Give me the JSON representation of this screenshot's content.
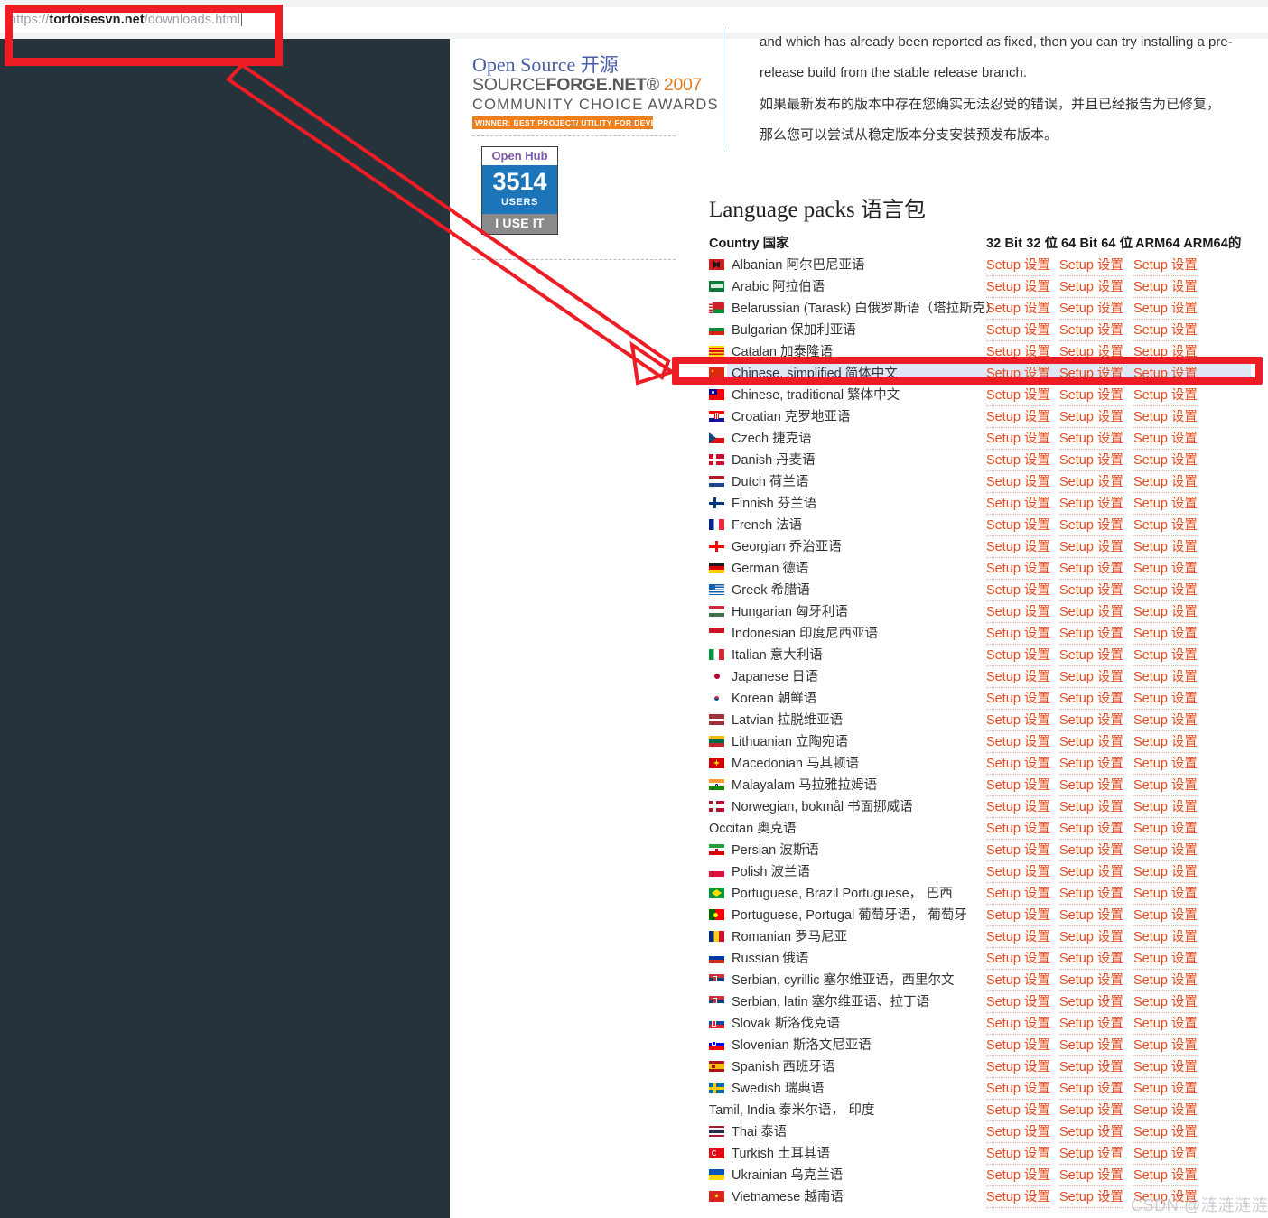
{
  "browser": {
    "url_scheme": "https://",
    "url_host": "tortoisesvn.net",
    "url_path": "/downloads.html",
    "url_full": "https://tortoisesvn.net/downloads.html"
  },
  "sidebar_widgets": {
    "sourceforge_award": {
      "line1_en": "Open Source ",
      "line1_cn": "开源",
      "line2_plain": "SOURCE",
      "line2_bold": "FORGE.NET",
      "line2_reg": "®",
      "line2_year": "2007",
      "line3": "COMMUNITY  CHOICE  AWARDS",
      "banner": "WINNER: BEST PROJECT/ UTILITY FOR DEVELOPERS"
    },
    "openhub_badge": {
      "title": "Open Hub",
      "count": "3514",
      "unit": "USERS",
      "cta": "I USE IT"
    }
  },
  "article": {
    "paragraph_en_clipped": "and which has already been reported as fixed, then you can try installing a pre-",
    "paragraph_en_line2": "release build from the stable release branch.",
    "paragraph_cn_line1": "如果最新发布的版本中存在您确实无法忍受的错误，并且已经报告为已修复，",
    "paragraph_cn_line2": "那么您可以尝试从稳定版本分支安装预发布版本。"
  },
  "language_packs": {
    "heading_en": "Language packs ",
    "heading_cn": "语言包",
    "columns": {
      "country": "Country 国家",
      "bit32": "32 Bit 32 位",
      "bit64": "64 Bit 64 位",
      "arm64": "ARM64 ARM64的"
    },
    "setup_label_en": "Setup ",
    "setup_label_cn": "设置",
    "rows": [
      {
        "flag": "f-albania",
        "name_en": "Albanian ",
        "name_cn": "阿尔巴尼亚语"
      },
      {
        "flag": "f-arabic",
        "name_en": "Arabic ",
        "name_cn": "阿拉伯语"
      },
      {
        "flag": "f-belarus",
        "name_en": "Belarussian (Tarask) ",
        "name_cn": "白俄罗斯语（塔拉斯克）"
      },
      {
        "flag": "f-bulgaria",
        "name_en": "Bulgarian ",
        "name_cn": "保加利亚语"
      },
      {
        "flag": "f-catalan",
        "name_en": "Catalan ",
        "name_cn": "加泰隆语"
      },
      {
        "flag": "f-china",
        "name_en": "Chinese, simplified ",
        "name_cn": "简体中文",
        "selected": true
      },
      {
        "flag": "f-taiwan",
        "name_en": "Chinese, traditional ",
        "name_cn": "繁体中文"
      },
      {
        "flag": "f-croatia",
        "name_en": "Croatian ",
        "name_cn": "克罗地亚语"
      },
      {
        "flag": "f-czech",
        "name_en": "Czech ",
        "name_cn": "捷克语"
      },
      {
        "flag": "f-denmark",
        "name_en": "Danish ",
        "name_cn": "丹麦语"
      },
      {
        "flag": "f-netherlands",
        "name_en": "Dutch ",
        "name_cn": "荷兰语"
      },
      {
        "flag": "f-finland",
        "name_en": "Finnish ",
        "name_cn": "芬兰语"
      },
      {
        "flag": "f-france",
        "name_en": "French ",
        "name_cn": "法语"
      },
      {
        "flag": "f-georgia",
        "name_en": "Georgian ",
        "name_cn": "乔治亚语"
      },
      {
        "flag": "f-germany",
        "name_en": "German ",
        "name_cn": "德语"
      },
      {
        "flag": "f-greece",
        "name_en": "Greek ",
        "name_cn": "希腊语"
      },
      {
        "flag": "f-hungary",
        "name_en": "Hungarian ",
        "name_cn": "匈牙利语"
      },
      {
        "flag": "f-indonesia",
        "name_en": "Indonesian ",
        "name_cn": "印度尼西亚语"
      },
      {
        "flag": "f-italy",
        "name_en": "Italian ",
        "name_cn": "意大利语"
      },
      {
        "flag": "f-japan",
        "name_en": "Japanese ",
        "name_cn": "日语"
      },
      {
        "flag": "f-korea",
        "name_en": "Korean ",
        "name_cn": "朝鲜语"
      },
      {
        "flag": "f-latvia",
        "name_en": "Latvian ",
        "name_cn": "拉脱维亚语"
      },
      {
        "flag": "f-lithuania",
        "name_en": "Lithuanian ",
        "name_cn": "立陶宛语"
      },
      {
        "flag": "f-macedonia",
        "name_en": "Macedonian ",
        "name_cn": "马其顿语"
      },
      {
        "flag": "f-india",
        "name_en": "Malayalam ",
        "name_cn": "马拉雅拉姆语"
      },
      {
        "flag": "f-norway",
        "name_en": "Norwegian, bokmål ",
        "name_cn": "书面挪威语"
      },
      {
        "flag": "",
        "name_en": "Occitan ",
        "name_cn": "奥克语"
      },
      {
        "flag": "f-iran",
        "name_en": "Persian ",
        "name_cn": "波斯语"
      },
      {
        "flag": "f-poland",
        "name_en": "Polish ",
        "name_cn": "波兰语"
      },
      {
        "flag": "f-brazil",
        "name_en": "Portuguese, Brazil Portuguese，",
        "name_cn": " 巴西"
      },
      {
        "flag": "f-portugal",
        "name_en": "Portuguese, Portugal ",
        "name_cn": "葡萄牙语， 葡萄牙"
      },
      {
        "flag": "f-romania",
        "name_en": "Romanian ",
        "name_cn": "罗马尼亚"
      },
      {
        "flag": "f-russia",
        "name_en": "Russian ",
        "name_cn": "俄语"
      },
      {
        "flag": "f-serbia",
        "name_en": "Serbian, cyrillic ",
        "name_cn": "塞尔维亚语，西里尔文"
      },
      {
        "flag": "f-serbia",
        "name_en": "Serbian, latin ",
        "name_cn": "塞尔维亚语、拉丁语"
      },
      {
        "flag": "f-slovakia",
        "name_en": "Slovak ",
        "name_cn": "斯洛伐克语"
      },
      {
        "flag": "f-slovenia",
        "name_en": "Slovenian ",
        "name_cn": "斯洛文尼亚语"
      },
      {
        "flag": "f-spain",
        "name_en": "Spanish ",
        "name_cn": "西班牙语"
      },
      {
        "flag": "f-sweden",
        "name_en": "Swedish ",
        "name_cn": "瑞典语"
      },
      {
        "flag": "",
        "name_en": "Tamil, India ",
        "name_cn": "泰米尔语， 印度"
      },
      {
        "flag": "f-thailand",
        "name_en": "Thai ",
        "name_cn": "泰语"
      },
      {
        "flag": "f-turkey",
        "name_en": "Turkish ",
        "name_cn": "土耳其语"
      },
      {
        "flag": "f-ukraine",
        "name_en": "Ukrainian ",
        "name_cn": "乌克兰语"
      },
      {
        "flag": "f-vietnam",
        "name_en": "Vietnamese ",
        "name_cn": "越南语"
      }
    ]
  },
  "annotations": {
    "highlight_color": "#ee1c25",
    "selection_color": "#dfe7f5",
    "link_color": "#e8491d"
  },
  "watermark": {
    "prefix": "CSDN @",
    "handle": "涟涟涟涟"
  }
}
